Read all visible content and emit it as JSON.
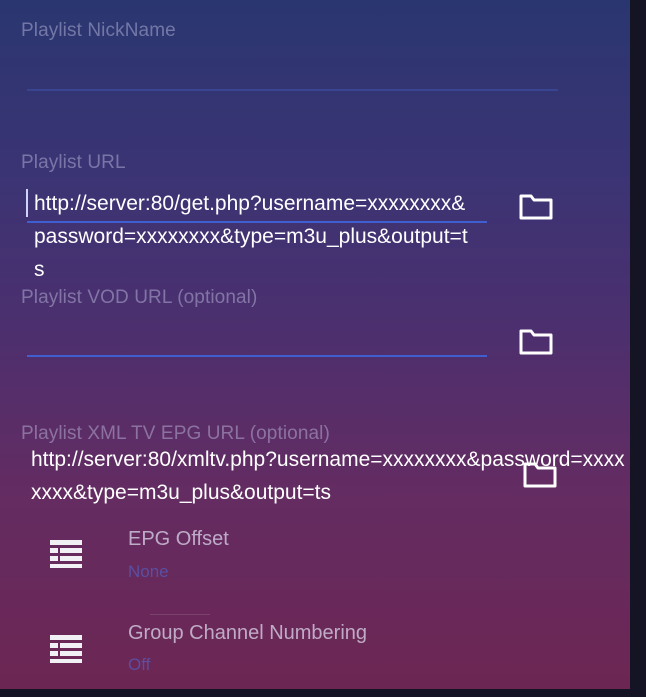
{
  "form": {
    "nickname": {
      "label": "Playlist NickName",
      "value": ""
    },
    "url": {
      "label": "Playlist URL",
      "value": "http://server:80/get.php?username=xxxxxxxx&password=xxxxxxxx&type=m3u_plus&output=ts"
    },
    "vod_url": {
      "label": "Playlist VOD URL (optional)",
      "value": ""
    },
    "epg_url": {
      "label": "Playlist XML TV EPG URL (optional)",
      "value": "http://server:80/xmltv.php?username=xxxxxxxx&password=xxxxxxxx&type=m3u_plus&output=ts"
    }
  },
  "settings": [
    {
      "title": "EPG Offset",
      "value": "None",
      "icon": "list-icon"
    },
    {
      "title": "Group Channel Numbering",
      "value": "Off",
      "icon": "list-icon"
    }
  ],
  "colors": {
    "accent_underline": "#3f5fd0",
    "text_white": "#ffffff"
  },
  "icons": {
    "browse": "folder-icon"
  }
}
